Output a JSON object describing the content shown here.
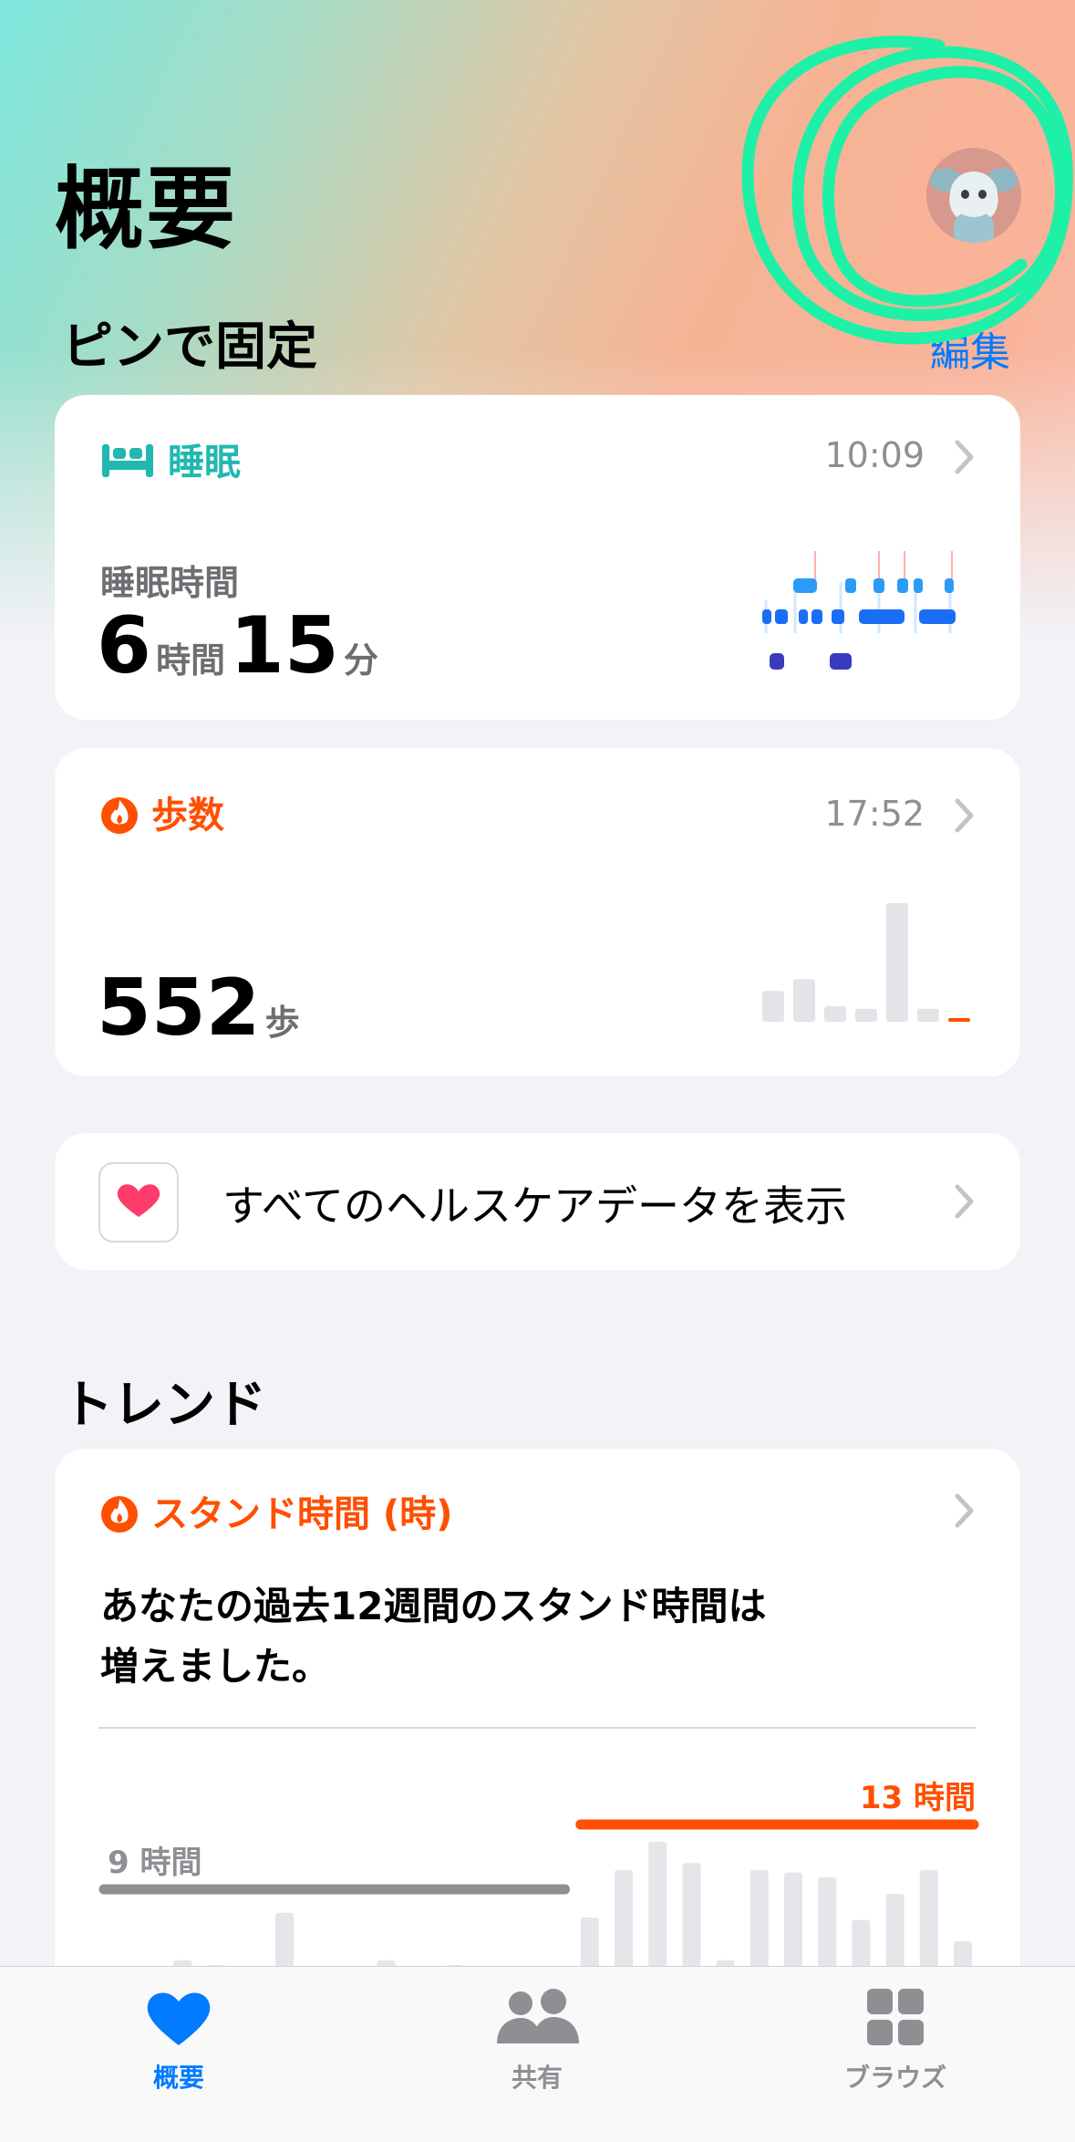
{
  "header": {
    "title": "概要"
  },
  "pinned": {
    "section_title": "ピンで固定",
    "edit_label": "編集"
  },
  "sleep": {
    "title": "睡眠",
    "time": "10:09",
    "label": "睡眠時間",
    "hours": "6",
    "hours_unit": "時間",
    "minutes": "15",
    "minutes_unit": "分",
    "accent_color": "#20b8b0"
  },
  "steps": {
    "title": "歩数",
    "time": "17:52",
    "value": "552",
    "unit": "歩",
    "accent_color": "#ff4f00",
    "mini_bars": [
      0.26,
      0.36,
      0.13,
      0.11,
      1.0,
      0.11,
      0.04
    ]
  },
  "health_data": {
    "label": "すべてのヘルスケアデータを表示"
  },
  "trends": {
    "section_title": "トレンド",
    "card_title": "スタンド時間 (時)",
    "message_line1": "あなたの過去12週間のスタンド時間は",
    "message_line2": "増えました。",
    "old_avg_label": "9 時間",
    "new_avg_label": "13 時間",
    "bar_values": [
      0.38,
      0.24,
      0.42,
      0.4,
      0.37,
      0.62,
      0.38,
      0.26,
      0.42,
      0.36,
      0.4,
      0.32,
      0.32,
      0.33,
      0.6,
      0.8,
      0.92,
      0.83,
      0.42,
      0.8,
      0.79,
      0.77,
      0.59,
      0.7,
      0.8,
      0.5
    ]
  },
  "tabbar": {
    "tabs": [
      {
        "label": "概要",
        "icon": "heart-icon",
        "active": true
      },
      {
        "label": "共有",
        "icon": "people-icon",
        "active": false
      },
      {
        "label": "ブラウズ",
        "icon": "grid-icon",
        "active": false
      }
    ],
    "active_color": "#007aff",
    "inactive_color": "#8e8e93"
  }
}
